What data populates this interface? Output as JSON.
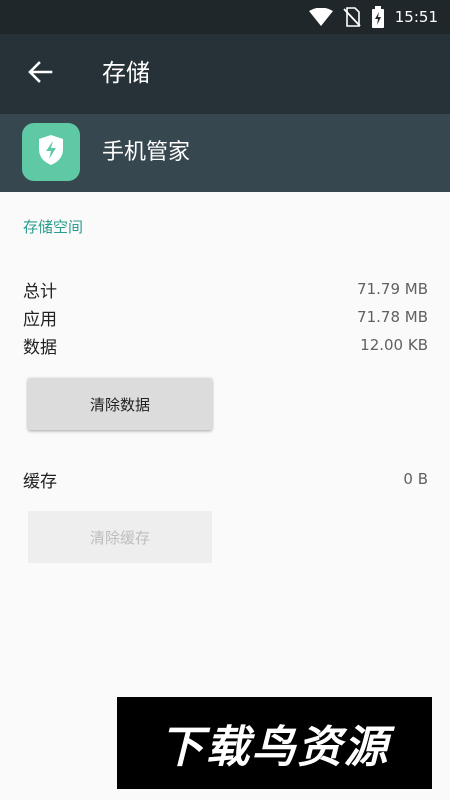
{
  "status_bar": {
    "time": "15:51"
  },
  "toolbar": {
    "title": "存储"
  },
  "app": {
    "name": "手机管家",
    "icon_color": "#5ec9a4"
  },
  "storage": {
    "section_title": "存储空间",
    "rows": [
      {
        "label": "总计",
        "value": "71.79 MB"
      },
      {
        "label": "应用",
        "value": "71.78 MB"
      },
      {
        "label": "数据",
        "value": "12.00 KB"
      }
    ],
    "clear_data_label": "清除数据"
  },
  "cache": {
    "label": "缓存",
    "value": "0 B",
    "clear_cache_label": "清除缓存"
  },
  "watermark": {
    "text": "下载鸟资源"
  }
}
